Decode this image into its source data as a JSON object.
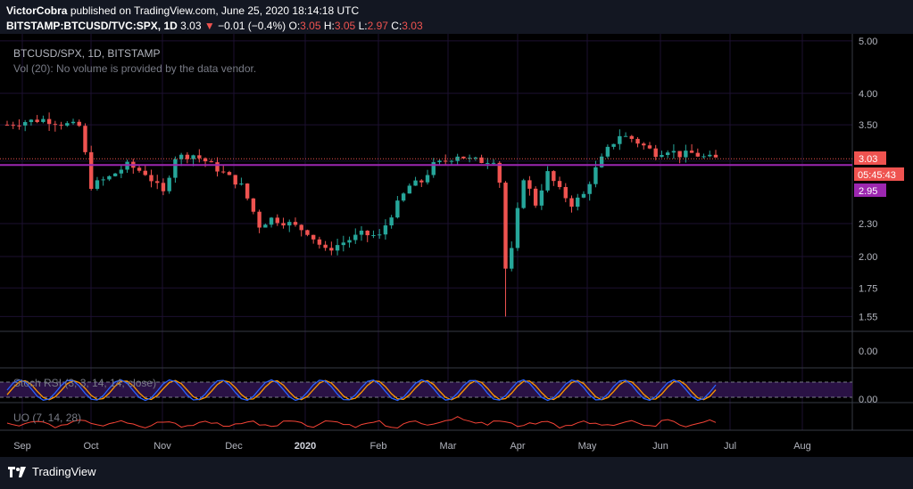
{
  "header": {
    "author": "VictorCobra",
    "published_text": "published on TradingView.com, June 25, 2020 18:14:18 UTC",
    "symbol": "BITSTAMP:BTCUSD/TVC:SPX, 1D",
    "price": "3.03",
    "change_arrow": "▼",
    "change": "−0.01 (−0.4%)",
    "o_label": "O:",
    "o_value": "3.05",
    "h_label": "H:",
    "h_value": "3.05",
    "l_label": "L:",
    "l_value": "2.97",
    "c_label": "C:",
    "c_value": "3.03"
  },
  "legend": {
    "main": "BTCUSD/SPX, 1D, BITSTAMP",
    "vol": "Vol (20): No volume is provided by the data vendor.",
    "stoch": "Stoch RSI (3, 3, 14, 14, close)",
    "uo": "UO (7, 14, 28)"
  },
  "price_labels": {
    "last": "3.03",
    "countdown": "05:45:43",
    "line": "2.95"
  },
  "footer": {
    "brand": "TradingView"
  },
  "colors": {
    "background": "#131722",
    "up": "#26a69a",
    "down": "#ef5350",
    "line": "#9c27b0",
    "stoch_k": "#2962ff",
    "stoch_d": "#ff9800",
    "uo": "#f44336"
  },
  "chart_data": {
    "type": "candlestick",
    "title": "BTCUSD/SPX, 1D, BITSTAMP",
    "x": [
      "Sep",
      "Oct",
      "Nov",
      "Dec",
      "2020",
      "Feb",
      "Mar",
      "Apr",
      "May",
      "Jun",
      "Jul",
      "Aug"
    ],
    "y_ticks": [
      5.0,
      4.0,
      3.5,
      3.0,
      2.3,
      2.0,
      1.75,
      1.55
    ],
    "y_labels": [
      "5.00",
      "4.00",
      "3.50",
      "3.00",
      "2.30",
      "2.00",
      "1.75",
      "1.55"
    ],
    "ylim": [
      1.45,
      5.15
    ],
    "y_scale": "log",
    "horizontal_line": 2.95,
    "last_price": 3.03,
    "close_series": [
      [
        0,
        3.5
      ],
      [
        3,
        3.55
      ],
      [
        6,
        3.58
      ],
      [
        9,
        3.52
      ],
      [
        12,
        3.48
      ],
      [
        14,
        2.7
      ],
      [
        17,
        2.8
      ],
      [
        20,
        2.95
      ],
      [
        23,
        2.85
      ],
      [
        26,
        2.62
      ],
      [
        28,
        3.05
      ],
      [
        31,
        3.08
      ],
      [
        33,
        3.0
      ],
      [
        36,
        2.85
      ],
      [
        39,
        2.7
      ],
      [
        42,
        2.28
      ],
      [
        44,
        2.35
      ],
      [
        47,
        2.3
      ],
      [
        50,
        2.22
      ],
      [
        53,
        2.05
      ],
      [
        55,
        2.1
      ],
      [
        57,
        2.15
      ],
      [
        59,
        2.2
      ],
      [
        62,
        2.18
      ],
      [
        65,
        2.5
      ],
      [
        67,
        2.7
      ],
      [
        69,
        2.75
      ],
      [
        71,
        2.95
      ],
      [
        73,
        3.0
      ],
      [
        75,
        3.08
      ],
      [
        77,
        3.02
      ],
      [
        79,
        3.0
      ],
      [
        81,
        3.02
      ],
      [
        82,
        2.75
      ],
      [
        83,
        1.9
      ],
      [
        84,
        2.05
      ],
      [
        86,
        2.8
      ],
      [
        88,
        2.5
      ],
      [
        90,
        2.85
      ],
      [
        92,
        2.65
      ],
      [
        94,
        2.5
      ],
      [
        96,
        2.6
      ],
      [
        98,
        2.9
      ],
      [
        100,
        3.15
      ],
      [
        102,
        3.35
      ],
      [
        104,
        3.3
      ],
      [
        106,
        3.2
      ],
      [
        108,
        3.1
      ],
      [
        110,
        3.15
      ],
      [
        112,
        3.08
      ],
      [
        114,
        3.1
      ],
      [
        116,
        3.05
      ],
      [
        118,
        3.03
      ]
    ],
    "stoch_rsi": {
      "upper": 80,
      "lower": 20,
      "range": [
        0,
        100
      ]
    },
    "uo": {
      "range": [
        0,
        100
      ]
    }
  }
}
